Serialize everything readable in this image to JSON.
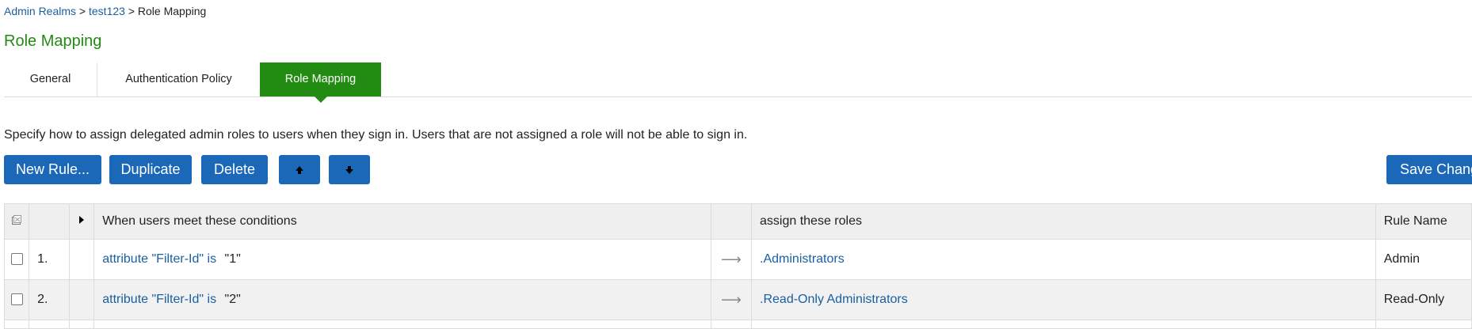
{
  "breadcrumb": {
    "items": [
      "Admin Realms",
      "test123"
    ],
    "separator": ">",
    "current": "Role Mapping"
  },
  "page_title": "Role Mapping",
  "tabs": [
    {
      "label": "General",
      "active": false
    },
    {
      "label": "Authentication Policy",
      "active": false
    },
    {
      "label": "Role Mapping",
      "active": true
    }
  ],
  "description": "Specify how to assign delegated admin roles to users when they sign in. Users that are not assigned a role will not be able to sign in.",
  "toolbar": {
    "new_rule_label": "New Rule...",
    "duplicate_label": "Duplicate",
    "delete_label": "Delete",
    "move_up_icon": "arrow-up-icon",
    "move_down_icon": "arrow-down-icon",
    "save_label": "Save Chang"
  },
  "table": {
    "headers": {
      "conditions": "When users meet these conditions",
      "roles": "assign these roles",
      "rule_name": "Rule Name"
    },
    "rows": [
      {
        "num": "1.",
        "condition_link": "attribute \"Filter-Id\" is",
        "condition_value": "\"1\"",
        "arrow": "⟶",
        "role": ".Administrators",
        "rule_name": "Admin"
      },
      {
        "num": "2.",
        "condition_link": "attribute \"Filter-Id\" is",
        "condition_value": "\"2\"",
        "arrow": "⟶",
        "role": ".Read-Only Administrators",
        "rule_name": "Read-Only"
      }
    ]
  },
  "colors": {
    "accent_green": "#228b12",
    "button_blue": "#1c68b8",
    "link_blue": "#1a5fa0"
  }
}
